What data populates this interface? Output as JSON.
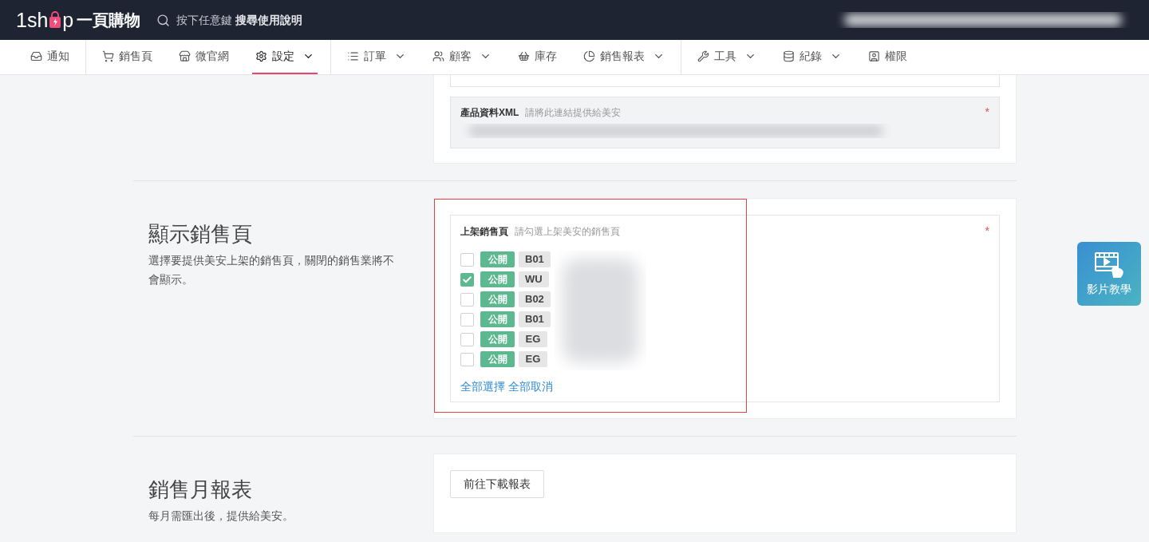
{
  "header": {
    "logo_start": "1sh",
    "logo_end": "p",
    "brand": "一頁購物",
    "search_hint": "按下任意鍵",
    "search_label": "搜尋使用說明"
  },
  "nav_groups": [
    [
      {
        "label": "通知",
        "has_menu": false,
        "selected": false
      }
    ],
    [
      {
        "label": "銷售頁",
        "has_menu": false,
        "selected": false
      },
      {
        "label": "微官網",
        "has_menu": false,
        "selected": false
      },
      {
        "label": "設定",
        "has_menu": true,
        "selected": true
      }
    ],
    [
      {
        "label": "訂單",
        "has_menu": true,
        "selected": false
      },
      {
        "label": "顧客",
        "has_menu": true,
        "selected": false
      },
      {
        "label": "庫存",
        "has_menu": false,
        "selected": false
      },
      {
        "label": "銷售報表",
        "has_menu": true,
        "selected": false
      }
    ],
    [
      {
        "label": "工具",
        "has_menu": true,
        "selected": false
      },
      {
        "label": "紀錄",
        "has_menu": true,
        "selected": false
      },
      {
        "label": "權限",
        "has_menu": false,
        "selected": false
      }
    ]
  ],
  "sections": [
    {
      "kind": "fields",
      "field": {
        "label": "產品資料XML",
        "hint": "請將此連結提供給美安",
        "required_mark": "*"
      }
    },
    {
      "kind": "pages",
      "title": "顯示銷售頁",
      "description": "選擇要提供美安上架的銷售頁，關閉的銷售業將不會顯示。",
      "field": {
        "label": "上架銷售頁",
        "hint": "請勾選上架美安的銷售頁",
        "required_mark": "*",
        "highlighted": true,
        "rows": [
          {
            "status": "公開",
            "code": "B01",
            "checked": false
          },
          {
            "status": "公開",
            "code": "WU",
            "checked": true
          },
          {
            "status": "公開",
            "code": "B02",
            "checked": false
          },
          {
            "status": "公開",
            "code": "B01",
            "checked": false
          },
          {
            "status": "公開",
            "code": "EG",
            "checked": false
          },
          {
            "status": "公開",
            "code": "EG",
            "checked": false
          }
        ],
        "select_all": "全部選擇",
        "deselect_all": "全部取消"
      }
    },
    {
      "kind": "report",
      "title": "銷售月報表",
      "description": "每月需匯出後，提供給美安。",
      "button": "前往下載報表"
    }
  ],
  "video_button": "影片教學"
}
